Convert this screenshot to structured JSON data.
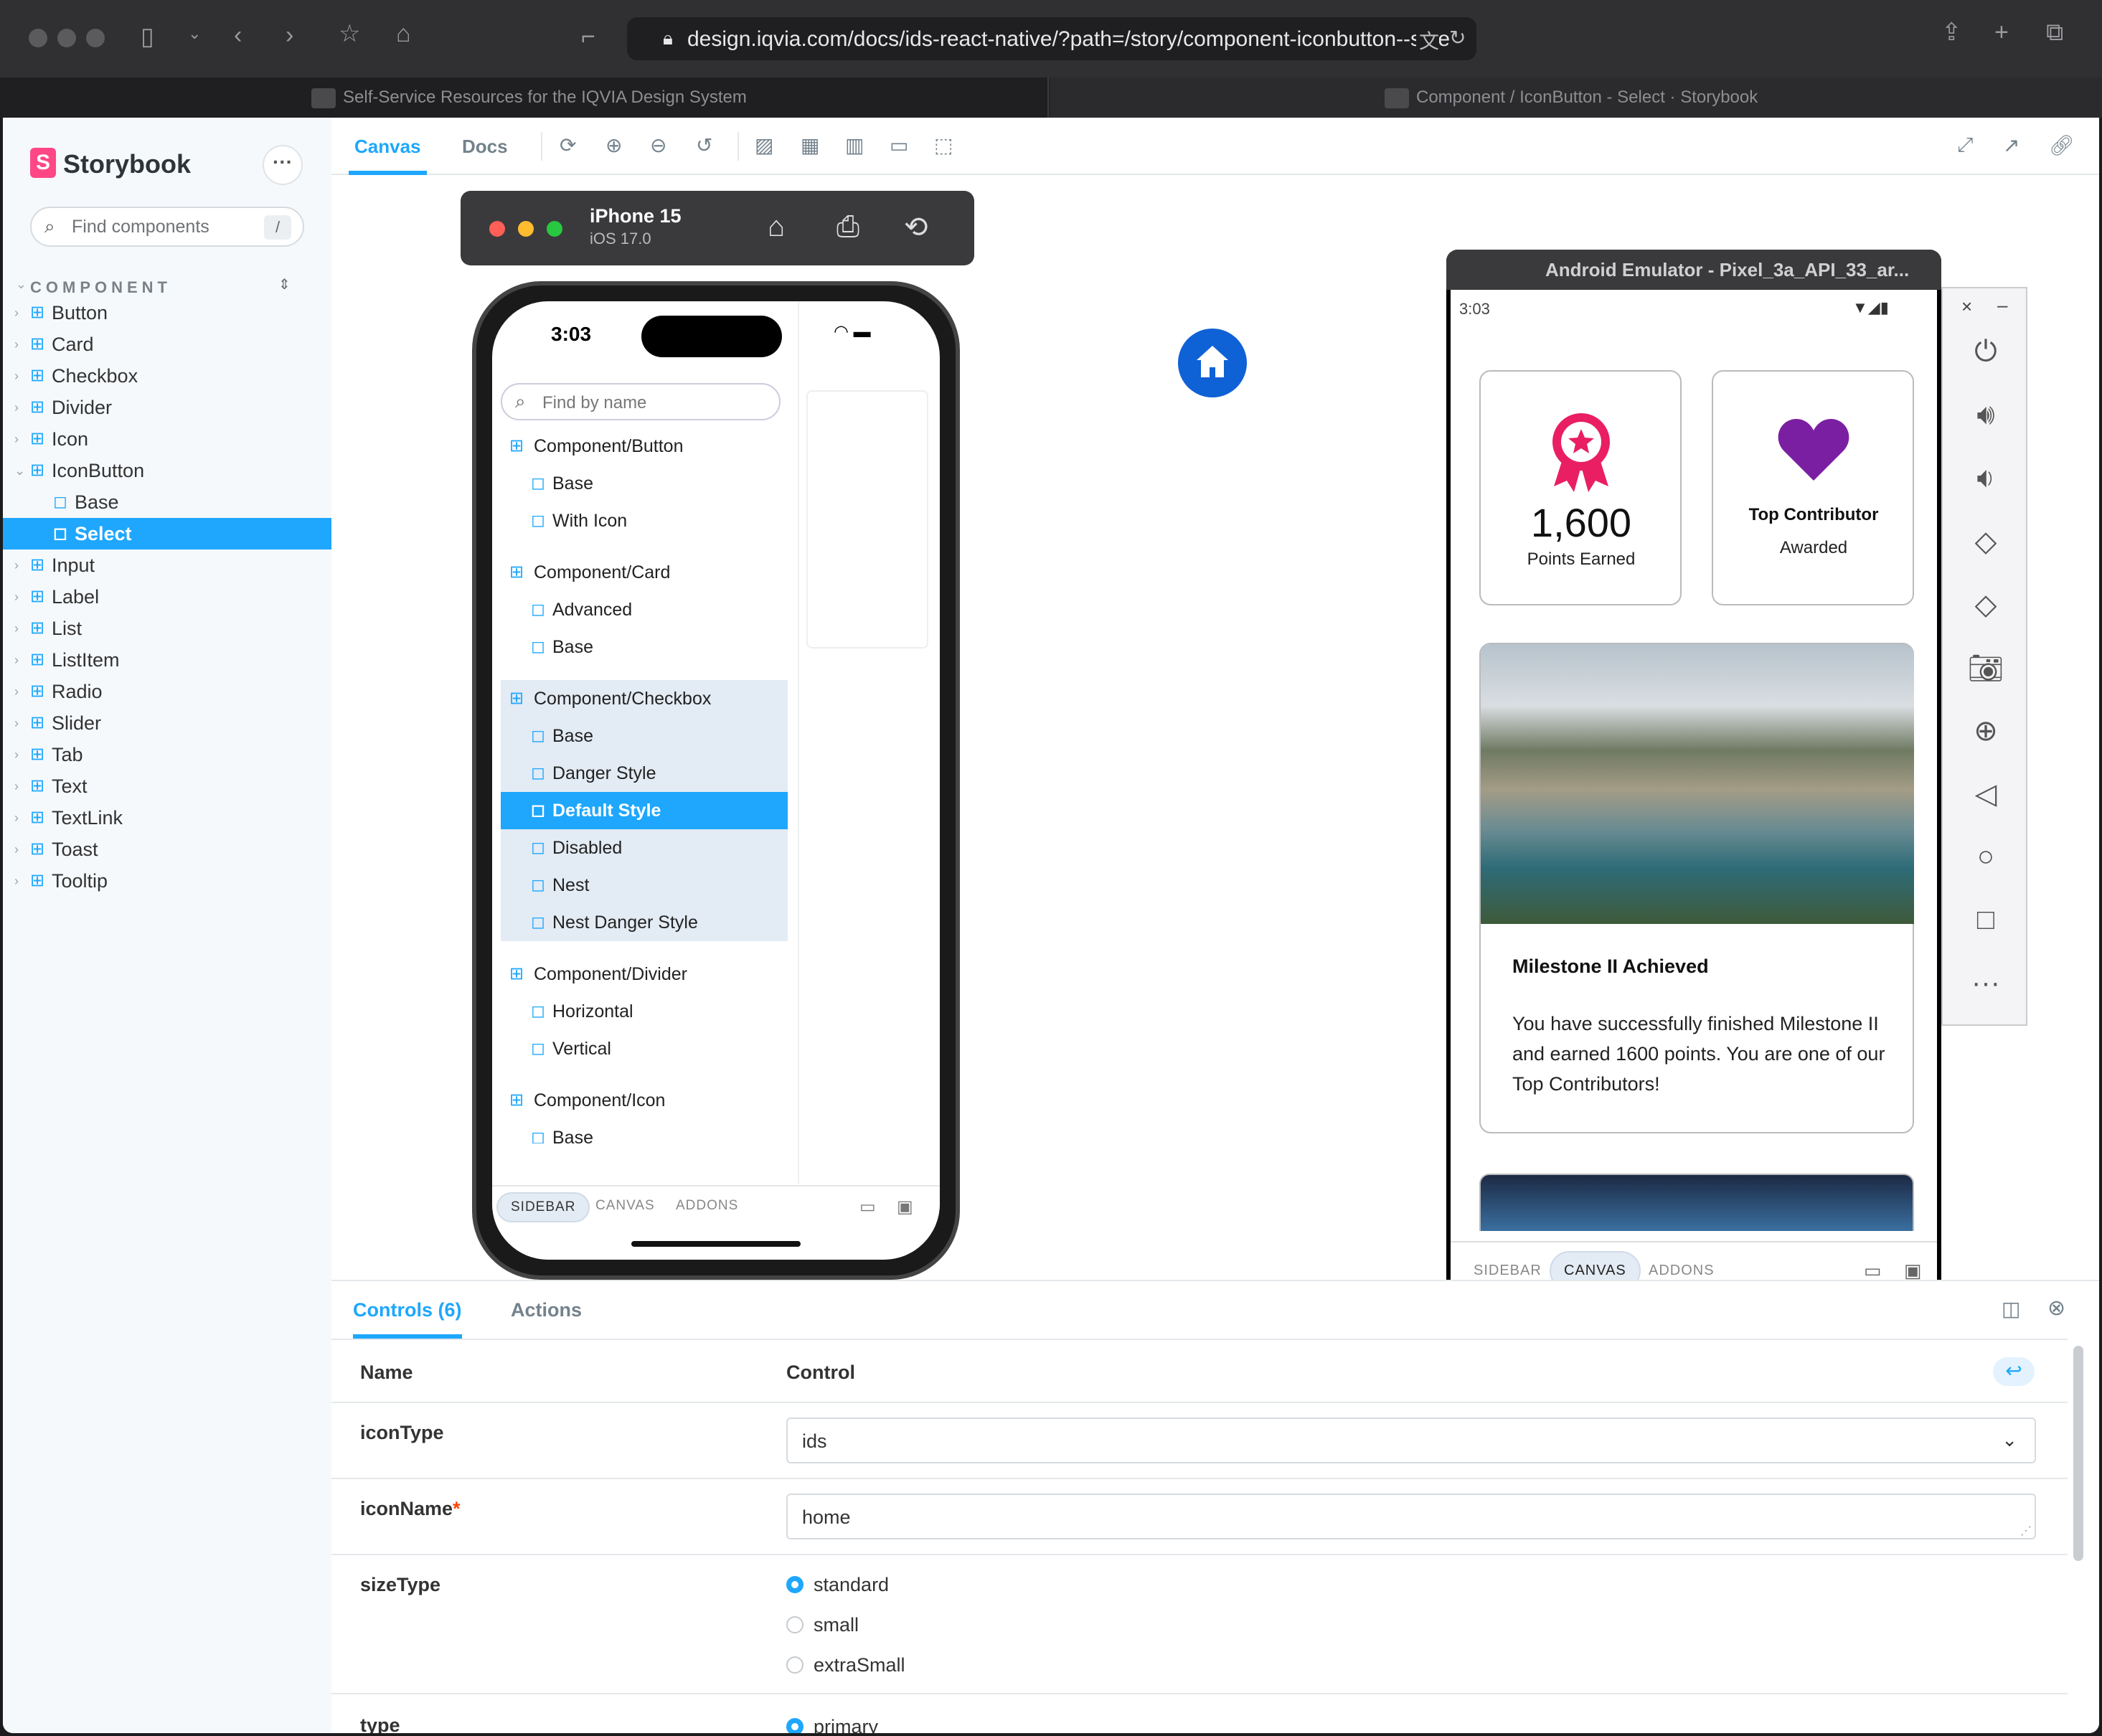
{
  "browser": {
    "url": "design.iqvia.com/docs/ids-react-native/?path=/story/component-iconbutton--sele",
    "tabs": [
      {
        "label": "Self-Service Resources for the IQVIA Design System"
      },
      {
        "label": "Component / IconButton - Select · Storybook"
      }
    ]
  },
  "sidebar": {
    "brand": "Storybook",
    "search_placeholder": "Find components",
    "search_shortcut": "/",
    "section": "COMPONENT",
    "items": [
      "Button",
      "Card",
      "Checkbox",
      "Divider",
      "Icon",
      "IconButton",
      "Base",
      "Select",
      "Input",
      "Label",
      "List",
      "ListItem",
      "Radio",
      "Slider",
      "Tab",
      "Text",
      "TextLink",
      "Toast",
      "Tooltip"
    ],
    "selected": "Select"
  },
  "toolbar": {
    "tab_canvas": "Canvas",
    "tab_docs": "Docs"
  },
  "ios_sim": {
    "device": "iPhone 15",
    "os": "iOS 17.0",
    "time": "3:03",
    "search_placeholder": "Find by name",
    "list": [
      {
        "label": "Component/Button",
        "kind": "group"
      },
      {
        "label": "Base",
        "kind": "story"
      },
      {
        "label": "With Icon",
        "kind": "story"
      },
      {
        "label": "Component/Card",
        "kind": "group"
      },
      {
        "label": "Advanced",
        "kind": "story"
      },
      {
        "label": "Base",
        "kind": "story"
      },
      {
        "label": "Component/Checkbox",
        "kind": "group"
      },
      {
        "label": "Base",
        "kind": "story"
      },
      {
        "label": "Danger Style",
        "kind": "story"
      },
      {
        "label": "Default Style",
        "kind": "story"
      },
      {
        "label": "Disabled",
        "kind": "story"
      },
      {
        "label": "Nest",
        "kind": "story"
      },
      {
        "label": "Nest Danger Style",
        "kind": "story"
      },
      {
        "label": "Component/Divider",
        "kind": "group"
      },
      {
        "label": "Horizontal",
        "kind": "story"
      },
      {
        "label": "Vertical",
        "kind": "story"
      },
      {
        "label": "Component/Icon",
        "kind": "group"
      },
      {
        "label": "Base",
        "kind": "story"
      }
    ],
    "bottom_tabs": [
      "SIDEBAR",
      "CANVAS",
      "ADDONS"
    ]
  },
  "android": {
    "title": "Android Emulator - Pixel_3a_API_33_ar...",
    "time": "3:03",
    "points_value": "1,600",
    "points_label": "Points Earned",
    "contributor_title": "Top Contributor",
    "contributor_sub": "Awarded",
    "milestone_title": "Milestone II Achieved",
    "milestone_body": "You have successfully finished Milestone II and earned 1600 points. You are one of our Top Contributors!",
    "bottom_tabs": [
      "SIDEBAR",
      "CANVAS",
      "ADDONS"
    ],
    "badge_color": "#e91e63",
    "heart_color": "#7b1fa2"
  },
  "addons": {
    "tab_controls": "Controls (6)",
    "tab_actions": "Actions",
    "col_name": "Name",
    "col_control": "Control",
    "iconType": {
      "name": "iconType",
      "value": "ids"
    },
    "iconName": {
      "name": "iconName",
      "value": "home",
      "required": "*"
    },
    "sizeType": {
      "name": "sizeType",
      "options": [
        "standard",
        "small",
        "extraSmall"
      ],
      "selected": "standard"
    },
    "type": {
      "name": "type",
      "first_option": "primary"
    }
  }
}
